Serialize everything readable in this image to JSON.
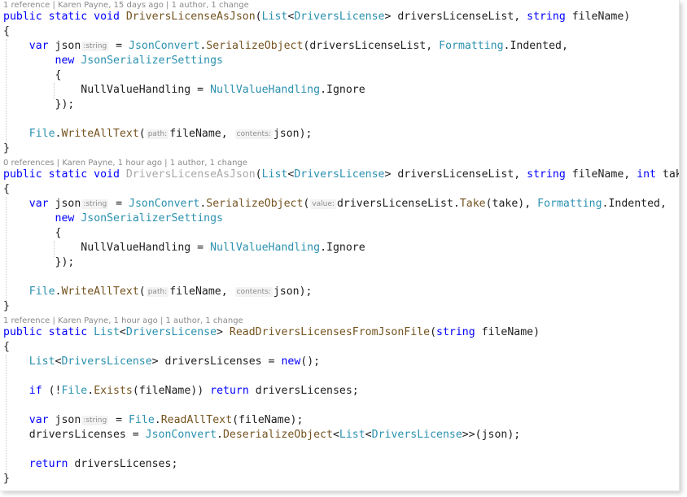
{
  "code_lens": [
    "1 reference | Karen Payne, 15 days ago | 1 author, 1 change",
    "0 references | Karen Payne, 1 hour ago | 1 author, 1 change",
    "1 reference | Karen Payne, 1 hour ago | 1 author, 1 change"
  ],
  "colors": {
    "keyword": "#0000ff",
    "type": "#2b91af",
    "identifier": "#1e1e1e",
    "method": "#74531f",
    "faded": "#a8a8a8",
    "hint": "#8e8e8e",
    "codelens": "#8a8a8a"
  },
  "code_lines": [
    [
      {
        "t": "kw",
        "v": "public static void "
      },
      {
        "t": "method",
        "v": "DriversLicenseAsJson"
      },
      {
        "t": "id",
        "v": "("
      },
      {
        "t": "type",
        "v": "List"
      },
      {
        "t": "id",
        "v": "<"
      },
      {
        "t": "type",
        "v": "DriversLicense"
      },
      {
        "t": "id",
        "v": "> driversLicenseList, "
      },
      {
        "t": "kw",
        "v": "string"
      },
      {
        "t": "id",
        "v": " fileName)"
      }
    ],
    [
      {
        "t": "id",
        "v": "{"
      }
    ],
    [
      {
        "t": "id",
        "v": "    "
      },
      {
        "t": "kw",
        "v": "var"
      },
      {
        "t": "id",
        "v": " json"
      },
      {
        "t": "hint",
        "v": ":string"
      },
      {
        "t": "id",
        "v": " = "
      },
      {
        "t": "type",
        "v": "JsonConvert"
      },
      {
        "t": "id",
        "v": "."
      },
      {
        "t": "method",
        "v": "SerializeObject"
      },
      {
        "t": "id",
        "v": "(driversLicenseList, "
      },
      {
        "t": "type",
        "v": "Formatting"
      },
      {
        "t": "id",
        "v": ".Indented,"
      }
    ],
    [
      {
        "t": "id",
        "v": "        "
      },
      {
        "t": "kw",
        "v": "new"
      },
      {
        "t": "id",
        "v": " "
      },
      {
        "t": "type",
        "v": "JsonSerializerSettings"
      }
    ],
    [
      {
        "t": "id",
        "v": "        {"
      }
    ],
    [
      {
        "t": "id",
        "v": "            NullValueHandling = "
      },
      {
        "t": "type",
        "v": "NullValueHandling"
      },
      {
        "t": "id",
        "v": ".Ignore"
      }
    ],
    [
      {
        "t": "id",
        "v": "        });"
      }
    ],
    [],
    [
      {
        "t": "id",
        "v": "    "
      },
      {
        "t": "type",
        "v": "File"
      },
      {
        "t": "id",
        "v": "."
      },
      {
        "t": "method",
        "v": "WriteAllText"
      },
      {
        "t": "id",
        "v": "("
      },
      {
        "t": "hint",
        "v": "path:"
      },
      {
        "t": "id",
        "v": "fileName, "
      },
      {
        "t": "hint",
        "v": "contents:"
      },
      {
        "t": "id",
        "v": "json);"
      }
    ],
    [
      {
        "t": "id",
        "v": "}"
      }
    ],
    [
      {
        "t": "kw",
        "v": "public static void "
      },
      {
        "t": "faded",
        "v": "DriversLicenseAsJson"
      },
      {
        "t": "id",
        "v": "("
      },
      {
        "t": "type",
        "v": "List"
      },
      {
        "t": "id",
        "v": "<"
      },
      {
        "t": "type",
        "v": "DriversLicense"
      },
      {
        "t": "id",
        "v": "> driversLicenseList, "
      },
      {
        "t": "kw",
        "v": "string"
      },
      {
        "t": "id",
        "v": " fileName, "
      },
      {
        "t": "kw",
        "v": "int"
      },
      {
        "t": "id",
        "v": " take)"
      }
    ],
    [
      {
        "t": "id",
        "v": "{"
      }
    ],
    [
      {
        "t": "id",
        "v": "    "
      },
      {
        "t": "kw",
        "v": "var"
      },
      {
        "t": "id",
        "v": " json"
      },
      {
        "t": "hint",
        "v": ":string"
      },
      {
        "t": "id",
        "v": " = "
      },
      {
        "t": "type",
        "v": "JsonConvert"
      },
      {
        "t": "id",
        "v": "."
      },
      {
        "t": "method",
        "v": "SerializeObject"
      },
      {
        "t": "id",
        "v": "("
      },
      {
        "t": "hint",
        "v": "value:"
      },
      {
        "t": "id",
        "v": "driversLicenseList."
      },
      {
        "t": "method",
        "v": "Take"
      },
      {
        "t": "id",
        "v": "(take), "
      },
      {
        "t": "type",
        "v": "Formatting"
      },
      {
        "t": "id",
        "v": ".Indented,"
      }
    ],
    [
      {
        "t": "id",
        "v": "        "
      },
      {
        "t": "kw",
        "v": "new"
      },
      {
        "t": "id",
        "v": " "
      },
      {
        "t": "type",
        "v": "JsonSerializerSettings"
      }
    ],
    [
      {
        "t": "id",
        "v": "        {"
      }
    ],
    [
      {
        "t": "id",
        "v": "            NullValueHandling = "
      },
      {
        "t": "type",
        "v": "NullValueHandling"
      },
      {
        "t": "id",
        "v": ".Ignore"
      }
    ],
    [
      {
        "t": "id",
        "v": "        });"
      }
    ],
    [],
    [
      {
        "t": "id",
        "v": "    "
      },
      {
        "t": "type",
        "v": "File"
      },
      {
        "t": "id",
        "v": "."
      },
      {
        "t": "method",
        "v": "WriteAllText"
      },
      {
        "t": "id",
        "v": "("
      },
      {
        "t": "hint",
        "v": "path:"
      },
      {
        "t": "id",
        "v": "fileName, "
      },
      {
        "t": "hint",
        "v": "contents:"
      },
      {
        "t": "id",
        "v": "json);"
      }
    ],
    [
      {
        "t": "id",
        "v": "}"
      }
    ],
    [
      {
        "t": "kw",
        "v": "public static "
      },
      {
        "t": "type",
        "v": "List"
      },
      {
        "t": "id",
        "v": "<"
      },
      {
        "t": "type",
        "v": "DriversLicense"
      },
      {
        "t": "id",
        "v": "> "
      },
      {
        "t": "method",
        "v": "ReadDriversLicensesFromJsonFile"
      },
      {
        "t": "id",
        "v": "("
      },
      {
        "t": "kw",
        "v": "string"
      },
      {
        "t": "id",
        "v": " fileName)"
      }
    ],
    [
      {
        "t": "id",
        "v": "{"
      }
    ],
    [
      {
        "t": "id",
        "v": "    "
      },
      {
        "t": "type",
        "v": "List"
      },
      {
        "t": "id",
        "v": "<"
      },
      {
        "t": "type",
        "v": "DriversLicense"
      },
      {
        "t": "id",
        "v": "> driversLicenses = "
      },
      {
        "t": "kw",
        "v": "new"
      },
      {
        "t": "id",
        "v": "();"
      }
    ],
    [],
    [
      {
        "t": "id",
        "v": "    "
      },
      {
        "t": "kw",
        "v": "if"
      },
      {
        "t": "id",
        "v": " (!"
      },
      {
        "t": "type",
        "v": "File"
      },
      {
        "t": "id",
        "v": "."
      },
      {
        "t": "method",
        "v": "Exists"
      },
      {
        "t": "id",
        "v": "(fileName)) "
      },
      {
        "t": "kw",
        "v": "return"
      },
      {
        "t": "id",
        "v": " driversLicenses;"
      }
    ],
    [],
    [
      {
        "t": "id",
        "v": "    "
      },
      {
        "t": "kw",
        "v": "var"
      },
      {
        "t": "id",
        "v": " json"
      },
      {
        "t": "hint",
        "v": ":string"
      },
      {
        "t": "id",
        "v": " = "
      },
      {
        "t": "type",
        "v": "File"
      },
      {
        "t": "id",
        "v": "."
      },
      {
        "t": "method",
        "v": "ReadAllText"
      },
      {
        "t": "id",
        "v": "(fileName);"
      }
    ],
    [
      {
        "t": "id",
        "v": "    driversLicenses = "
      },
      {
        "t": "type",
        "v": "JsonConvert"
      },
      {
        "t": "id",
        "v": "."
      },
      {
        "t": "method",
        "v": "DeserializeObject"
      },
      {
        "t": "id",
        "v": "<"
      },
      {
        "t": "type",
        "v": "List"
      },
      {
        "t": "id",
        "v": "<"
      },
      {
        "t": "type",
        "v": "DriversLicense"
      },
      {
        "t": "id",
        "v": ">>(json);"
      }
    ],
    [],
    [
      {
        "t": "id",
        "v": "    "
      },
      {
        "t": "kw",
        "v": "return"
      },
      {
        "t": "id",
        "v": " driversLicenses;"
      }
    ],
    [
      {
        "t": "id",
        "v": "}"
      }
    ]
  ]
}
